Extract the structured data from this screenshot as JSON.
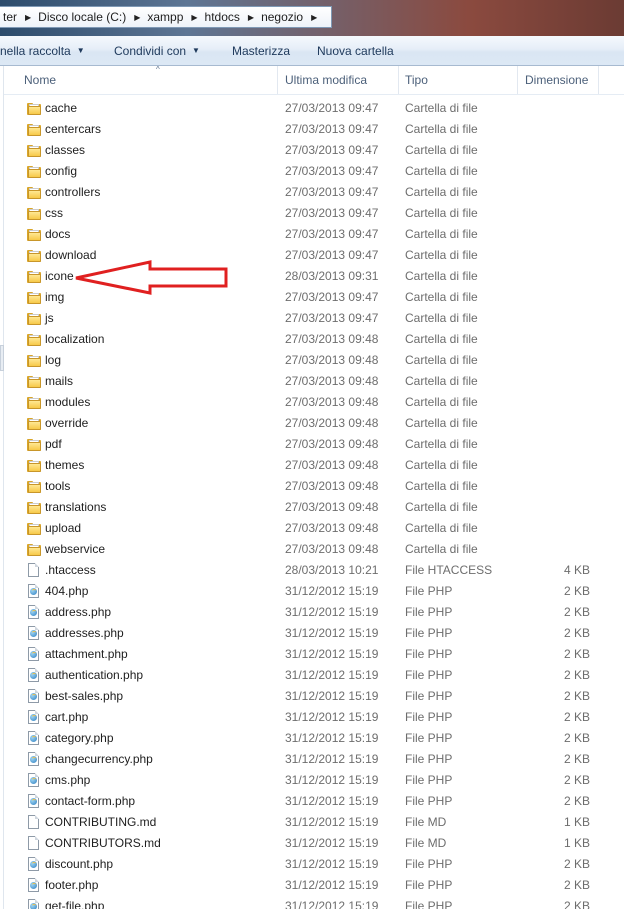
{
  "breadcrumb": [
    "ter",
    "Disco locale (C:)",
    "xampp",
    "htdocs",
    "negozio"
  ],
  "toolbar": {
    "include_library": "nella raccolta",
    "share": "Condividi con",
    "burn": "Masterizza",
    "new_folder": "Nuova cartella"
  },
  "columns": {
    "name": "Nome",
    "modified": "Ultima modifica",
    "type": "Tipo",
    "size": "Dimensione"
  },
  "files": [
    {
      "name": "cache",
      "date": "27/03/2013 09:47",
      "type": "Cartella di file",
      "size": "",
      "icon": "folder-icon"
    },
    {
      "name": "centercars",
      "date": "27/03/2013 09:47",
      "type": "Cartella di file",
      "size": "",
      "icon": "folder-icon"
    },
    {
      "name": "classes",
      "date": "27/03/2013 09:47",
      "type": "Cartella di file",
      "size": "",
      "icon": "folder-icon"
    },
    {
      "name": "config",
      "date": "27/03/2013 09:47",
      "type": "Cartella di file",
      "size": "",
      "icon": "folder-icon"
    },
    {
      "name": "controllers",
      "date": "27/03/2013 09:47",
      "type": "Cartella di file",
      "size": "",
      "icon": "folder-icon"
    },
    {
      "name": "css",
      "date": "27/03/2013 09:47",
      "type": "Cartella di file",
      "size": "",
      "icon": "folder-icon"
    },
    {
      "name": "docs",
      "date": "27/03/2013 09:47",
      "type": "Cartella di file",
      "size": "",
      "icon": "folder-icon"
    },
    {
      "name": "download",
      "date": "27/03/2013 09:47",
      "type": "Cartella di file",
      "size": "",
      "icon": "folder-icon"
    },
    {
      "name": "icone",
      "date": "28/03/2013 09:31",
      "type": "Cartella di file",
      "size": "",
      "icon": "folder-icon"
    },
    {
      "name": "img",
      "date": "27/03/2013 09:47",
      "type": "Cartella di file",
      "size": "",
      "icon": "folder-icon"
    },
    {
      "name": "js",
      "date": "27/03/2013 09:47",
      "type": "Cartella di file",
      "size": "",
      "icon": "folder-icon"
    },
    {
      "name": "localization",
      "date": "27/03/2013 09:48",
      "type": "Cartella di file",
      "size": "",
      "icon": "folder-icon"
    },
    {
      "name": "log",
      "date": "27/03/2013 09:48",
      "type": "Cartella di file",
      "size": "",
      "icon": "folder-icon"
    },
    {
      "name": "mails",
      "date": "27/03/2013 09:48",
      "type": "Cartella di file",
      "size": "",
      "icon": "folder-icon"
    },
    {
      "name": "modules",
      "date": "27/03/2013 09:48",
      "type": "Cartella di file",
      "size": "",
      "icon": "folder-icon"
    },
    {
      "name": "override",
      "date": "27/03/2013 09:48",
      "type": "Cartella di file",
      "size": "",
      "icon": "folder-icon"
    },
    {
      "name": "pdf",
      "date": "27/03/2013 09:48",
      "type": "Cartella di file",
      "size": "",
      "icon": "folder-icon"
    },
    {
      "name": "themes",
      "date": "27/03/2013 09:48",
      "type": "Cartella di file",
      "size": "",
      "icon": "folder-icon"
    },
    {
      "name": "tools",
      "date": "27/03/2013 09:48",
      "type": "Cartella di file",
      "size": "",
      "icon": "folder-icon"
    },
    {
      "name": "translations",
      "date": "27/03/2013 09:48",
      "type": "Cartella di file",
      "size": "",
      "icon": "folder-icon"
    },
    {
      "name": "upload",
      "date": "27/03/2013 09:48",
      "type": "Cartella di file",
      "size": "",
      "icon": "folder-icon"
    },
    {
      "name": "webservice",
      "date": "27/03/2013 09:48",
      "type": "Cartella di file",
      "size": "",
      "icon": "folder-icon"
    },
    {
      "name": ".htaccess",
      "date": "28/03/2013 10:21",
      "type": "File HTACCESS",
      "size": "4 KB",
      "icon": "file-icon"
    },
    {
      "name": "404.php",
      "date": "31/12/2012 15:19",
      "type": "File PHP",
      "size": "2 KB",
      "icon": "php-file-icon"
    },
    {
      "name": "address.php",
      "date": "31/12/2012 15:19",
      "type": "File PHP",
      "size": "2 KB",
      "icon": "php-file-icon"
    },
    {
      "name": "addresses.php",
      "date": "31/12/2012 15:19",
      "type": "File PHP",
      "size": "2 KB",
      "icon": "php-file-icon"
    },
    {
      "name": "attachment.php",
      "date": "31/12/2012 15:19",
      "type": "File PHP",
      "size": "2 KB",
      "icon": "php-file-icon"
    },
    {
      "name": "authentication.php",
      "date": "31/12/2012 15:19",
      "type": "File PHP",
      "size": "2 KB",
      "icon": "php-file-icon"
    },
    {
      "name": "best-sales.php",
      "date": "31/12/2012 15:19",
      "type": "File PHP",
      "size": "2 KB",
      "icon": "php-file-icon"
    },
    {
      "name": "cart.php",
      "date": "31/12/2012 15:19",
      "type": "File PHP",
      "size": "2 KB",
      "icon": "php-file-icon"
    },
    {
      "name": "category.php",
      "date": "31/12/2012 15:19",
      "type": "File PHP",
      "size": "2 KB",
      "icon": "php-file-icon"
    },
    {
      "name": "changecurrency.php",
      "date": "31/12/2012 15:19",
      "type": "File PHP",
      "size": "2 KB",
      "icon": "php-file-icon"
    },
    {
      "name": "cms.php",
      "date": "31/12/2012 15:19",
      "type": "File PHP",
      "size": "2 KB",
      "icon": "php-file-icon"
    },
    {
      "name": "contact-form.php",
      "date": "31/12/2012 15:19",
      "type": "File PHP",
      "size": "2 KB",
      "icon": "php-file-icon"
    },
    {
      "name": "CONTRIBUTING.md",
      "date": "31/12/2012 15:19",
      "type": "File MD",
      "size": "1 KB",
      "icon": "file-icon"
    },
    {
      "name": "CONTRIBUTORS.md",
      "date": "31/12/2012 15:19",
      "type": "File MD",
      "size": "1 KB",
      "icon": "file-icon"
    },
    {
      "name": "discount.php",
      "date": "31/12/2012 15:19",
      "type": "File PHP",
      "size": "2 KB",
      "icon": "php-file-icon"
    },
    {
      "name": "footer.php",
      "date": "31/12/2012 15:19",
      "type": "File PHP",
      "size": "2 KB",
      "icon": "php-file-icon"
    },
    {
      "name": "get-file.php",
      "date": "31/12/2012 15:19",
      "type": "File PHP",
      "size": "2 KB",
      "icon": "php-file-icon"
    }
  ],
  "annotation": {
    "target": "icone",
    "color": "#e02020",
    "shape": "red-arrow"
  }
}
